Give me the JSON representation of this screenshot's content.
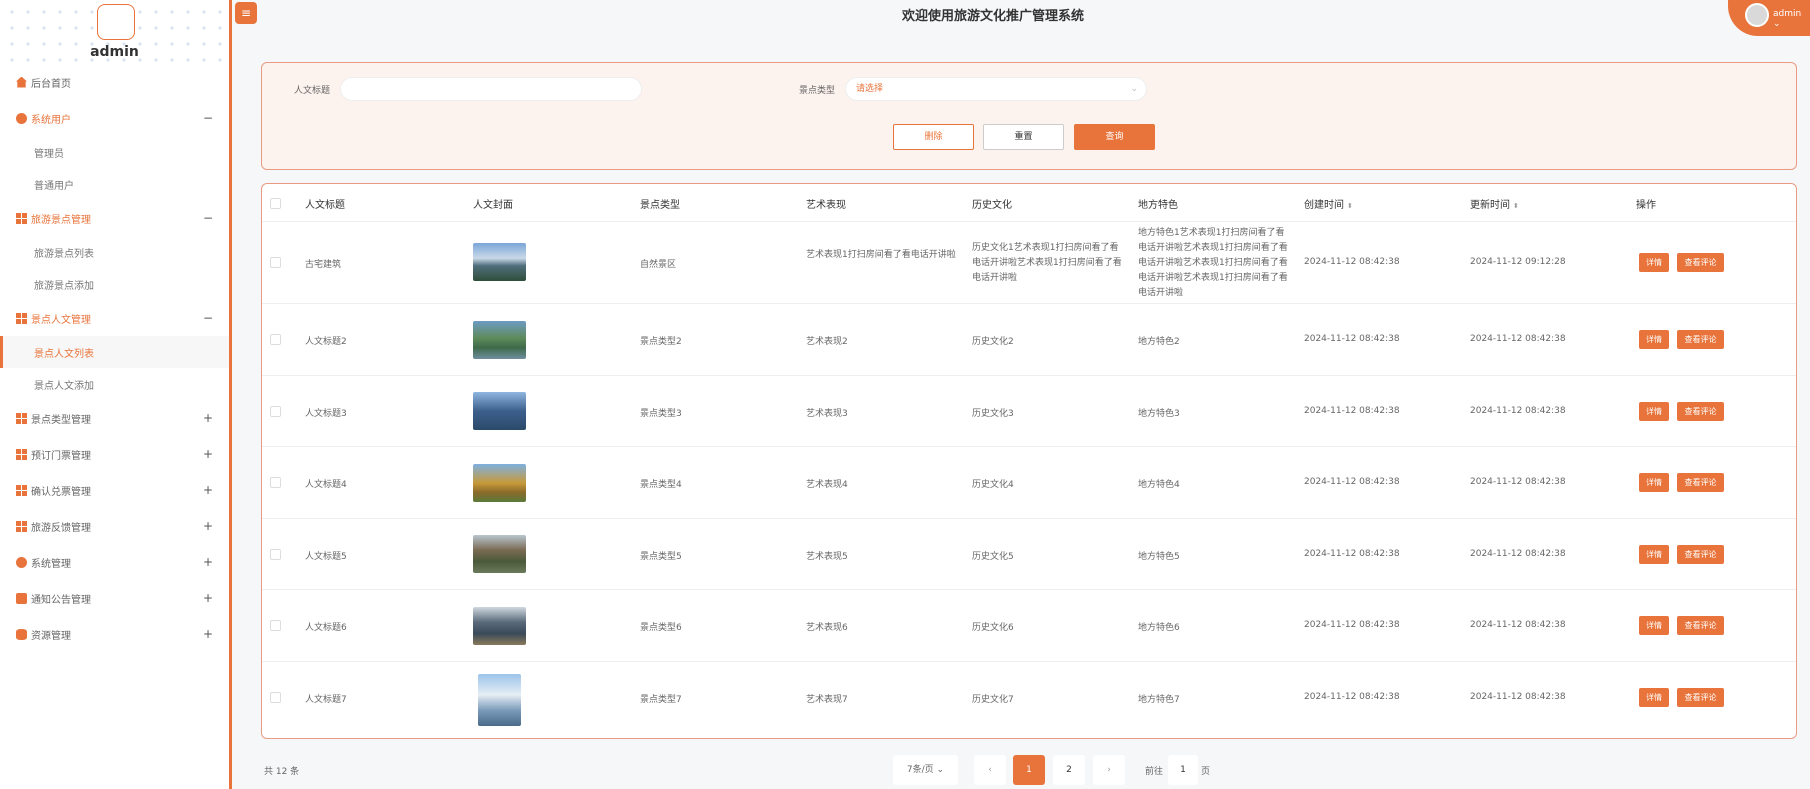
{
  "colors": {
    "accent": "#e8743b"
  },
  "header": {
    "title": "欢迎使用旅游文化推广管理系统",
    "user": "admin ⌄",
    "menu_icon": "hamburger-icon"
  },
  "sidebar": {
    "admin_name": "admin",
    "items": [
      {
        "label": "后台首页",
        "icon": "home-icon"
      },
      {
        "label": "系统用户",
        "icon": "user-circle-icon",
        "toggle": "−",
        "children": [
          "管理员",
          "普通用户"
        ]
      },
      {
        "label": "旅游景点管理",
        "icon": "grid-icon",
        "toggle": "−",
        "children": [
          "旅游景点列表",
          "旅游景点添加"
        ]
      },
      {
        "label": "景点人文管理",
        "icon": "grid-icon",
        "toggle": "−",
        "children": [
          "景点人文列表",
          "景点人文添加"
        ]
      },
      {
        "label": "景点类型管理",
        "icon": "grid-icon",
        "toggle": "+"
      },
      {
        "label": "预订门票管理",
        "icon": "grid-icon",
        "toggle": "+"
      },
      {
        "label": "确认兑票管理",
        "icon": "grid-icon",
        "toggle": "+"
      },
      {
        "label": "旅游反馈管理",
        "icon": "grid-icon",
        "toggle": "+"
      },
      {
        "label": "系统管理",
        "icon": "gear-icon",
        "toggle": "+"
      },
      {
        "label": "通知公告管理",
        "icon": "notice-icon",
        "toggle": "+"
      },
      {
        "label": "资源管理",
        "icon": "database-icon",
        "toggle": "+"
      }
    ]
  },
  "search": {
    "title_label": "人文标题",
    "title_value": "",
    "type_label": "景点类型",
    "type_placeholder": "请选择",
    "delete_label": "删除",
    "reset_label": "重置",
    "query_label": "查询"
  },
  "table": {
    "headers": [
      "人文标题",
      "人文封面",
      "景点类型",
      "艺术表现",
      "历史文化",
      "地方特色",
      "创建时间",
      "更新时间",
      "操作"
    ],
    "sort_icon": "sort-icon",
    "detail_label": "详情",
    "comment_label": "查看评论",
    "rows": [
      {
        "title": "古宅建筑",
        "cover": "bridge-landscape-image",
        "type": "自然景区",
        "art": "艺术表现1打扫房间看了看电话开讲啦",
        "history": "历史文化1艺术表现1打扫房间看了看电话开讲啦艺术表现1打扫房间看了看电话开讲啦",
        "local": "地方特色1艺术表现1打扫房间看了看电话开讲啦艺术表现1打扫房间看了看电话开讲啦艺术表现1打扫房间看了看电话开讲啦艺术表现1打扫房间看了看电话开讲啦",
        "created": "2024-11-12 08:42:38",
        "updated": "2024-11-12 09:12:28"
      },
      {
        "title": "人文标题2",
        "cover": "river-hills-image",
        "type": "景点类型2",
        "art": "艺术表现2",
        "history": "历史文化2",
        "local": "地方特色2",
        "created": "2024-11-12 08:42:38",
        "updated": "2024-11-12 08:42:38"
      },
      {
        "title": "人文标题3",
        "cover": "lake-temple-image",
        "type": "景点类型3",
        "art": "艺术表现3",
        "history": "历史文化3",
        "local": "地方特色3",
        "created": "2024-11-12 08:42:38",
        "updated": "2024-11-12 08:42:38"
      },
      {
        "title": "人文标题4",
        "cover": "pavilion-image",
        "type": "景点类型4",
        "art": "艺术表现4",
        "history": "历史文化4",
        "local": "地方特色4",
        "created": "2024-11-12 08:42:38",
        "updated": "2024-11-12 08:42:38"
      },
      {
        "title": "人文标题5",
        "cover": "village-image",
        "type": "景点类型5",
        "art": "艺术表现5",
        "history": "历史文化5",
        "local": "地方特色5",
        "created": "2024-11-12 08:42:38",
        "updated": "2024-11-12 08:42:38"
      },
      {
        "title": "人文标题6",
        "cover": "karst-river-image",
        "type": "景点类型6",
        "art": "艺术表现6",
        "history": "历史文化6",
        "local": "地方特色6",
        "created": "2024-11-12 08:42:38",
        "updated": "2024-11-12 08:42:38"
      },
      {
        "title": "人文标题7",
        "cover": "snow-mountain-image",
        "type": "景点类型7",
        "art": "艺术表现7",
        "history": "历史文化7",
        "local": "地方特色7",
        "created": "2024-11-12 08:42:38",
        "updated": "2024-11-12 08:42:38"
      }
    ]
  },
  "pagination": {
    "total": "共 12 条",
    "page_size": "7条/页 ⌄",
    "prev": "‹",
    "pages": [
      "1",
      "2"
    ],
    "current": "1",
    "next": "›",
    "goto_prefix": "前往",
    "goto_value": "1",
    "goto_suffix": "页"
  }
}
